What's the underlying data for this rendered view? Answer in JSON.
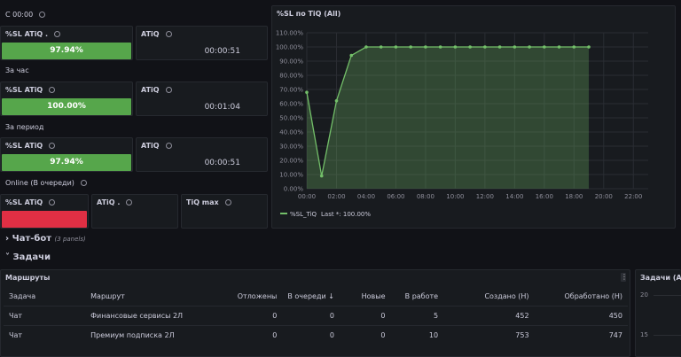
{
  "sections": {
    "s1": "С 00:00",
    "s2": "За час",
    "s3": "За период",
    "s4": "Online (В очереди)"
  },
  "stats": {
    "row1": {
      "sl_title": "%SL ATiQ .",
      "sl_value": "97.94%",
      "sl_fill": 0.9794,
      "atiq_title": "ATiQ",
      "atiq_value": "00:00:51"
    },
    "row2": {
      "sl_title": "%SL ATiQ",
      "sl_value": "100.00%",
      "sl_fill": 1.0,
      "atiq_title": "ATiQ",
      "atiq_value": "00:01:04"
    },
    "row3": {
      "sl_title": "%SL ATiQ",
      "sl_value": "97.94%",
      "sl_fill": 0.9794,
      "atiq_title": "ATiQ",
      "atiq_value": "00:00:51"
    },
    "row4": {
      "sl_title": "%SL ATiQ",
      "atiq_title": "ATiQ .",
      "tiqmax_title": "TiQ max"
    }
  },
  "rows": {
    "chatbot": "Чат-бот",
    "chatbot_count": "(3 panels)",
    "tasks": "Задачи"
  },
  "chart_data": {
    "type": "area",
    "title": "%SL по TiQ (All)",
    "x": [
      "00:00",
      "01:00",
      "02:00",
      "03:00",
      "04:00",
      "05:00",
      "06:00",
      "07:00",
      "08:00",
      "09:00",
      "10:00",
      "11:00",
      "12:00",
      "13:00",
      "14:00",
      "15:00",
      "16:00",
      "17:00",
      "18:00",
      "19:00"
    ],
    "series": [
      {
        "name": "%SL_TiQ",
        "values": [
          68,
          9,
          62,
          94,
          100,
          100,
          100,
          100,
          100,
          100,
          100,
          100,
          100,
          100,
          100,
          100,
          100,
          100,
          100,
          100
        ]
      }
    ],
    "x_ticks": [
      "00:00",
      "02:00",
      "04:00",
      "06:00",
      "08:00",
      "10:00",
      "12:00",
      "14:00",
      "16:00",
      "18:00",
      "20:00",
      "22:00"
    ],
    "y_ticks": [
      "0.00%",
      "10.00%",
      "20.00%",
      "30.00%",
      "40.00%",
      "50.00%",
      "60.00%",
      "70.00%",
      "80.00%",
      "90.00%",
      "100.00%",
      "110.00%"
    ],
    "ylim": [
      0,
      110
    ],
    "xlim_hours": [
      0,
      23
    ],
    "legend_text": "Last *: 100.00%",
    "line_color": "#73bf69"
  },
  "table": {
    "title": "Маршруты",
    "columns": [
      "Задача",
      "Маршрут",
      "Отложены",
      "В очереди",
      "Новые",
      "В работе",
      "Создано (Н)",
      "Обработано (Н)"
    ],
    "sort_icon": "arrow-down-icon",
    "rows": [
      [
        "Чат",
        "Финансовые сервисы 2Л",
        "0",
        "0",
        "0",
        "5",
        "452",
        "450"
      ],
      [
        "Чат",
        "Премиум подписка 2Л",
        "0",
        "0",
        "0",
        "10",
        "753",
        "747"
      ]
    ]
  },
  "side_panel": {
    "title": "Задачи (All)",
    "y_ticks": [
      "20",
      "15"
    ]
  },
  "colors": {
    "green": "#56a64b",
    "red": "#e02f44",
    "bg": "#111217",
    "panel": "#181b1f"
  }
}
